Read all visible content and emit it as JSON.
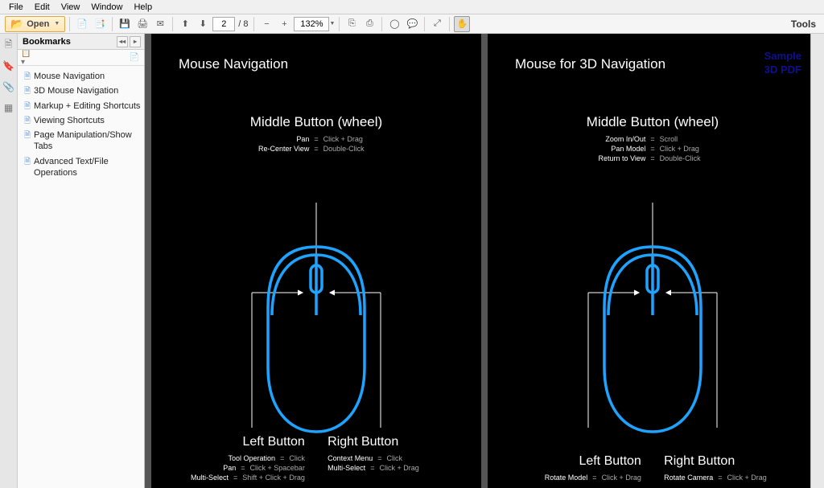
{
  "menu": [
    "File",
    "Edit",
    "View",
    "Window",
    "Help"
  ],
  "toolbar": {
    "open": "Open",
    "page_current": "2",
    "page_total": "/ 8",
    "zoom": "132%",
    "tools": "Tools"
  },
  "bookmarks": {
    "title": "Bookmarks",
    "items": [
      "Mouse Navigation",
      "3D Mouse Navigation",
      "Markup + Editing Shortcuts",
      "Viewing Shortcuts",
      "Page Manipulation/Show Tabs",
      "Advanced Text/File Operations"
    ]
  },
  "pages": [
    {
      "title": "Mouse Navigation",
      "watermark": "",
      "middle": {
        "heading": "Middle Button (wheel)",
        "rows": [
          {
            "k": "Pan",
            "v": "Click + Drag"
          },
          {
            "k": "Re-Center View",
            "v": "Double-Click"
          }
        ]
      },
      "left": {
        "heading": "Left Button",
        "rows": [
          {
            "k": "Tool Operation",
            "v": "Click"
          },
          {
            "k": "Pan",
            "v": "Click + Spacebar"
          },
          {
            "k": "Multi-Select",
            "v": "Shift + Click + Drag"
          }
        ]
      },
      "right": {
        "heading": "Right Button",
        "rows": [
          {
            "k": "Context Menu",
            "v": "Click"
          },
          {
            "k": "Multi-Select",
            "v": "Click + Drag"
          }
        ]
      }
    },
    {
      "title": "Mouse for 3D Navigation",
      "watermark": "Sample\n3D PDF",
      "middle": {
        "heading": "Middle Button (wheel)",
        "rows": [
          {
            "k": "Zoom In/Out",
            "v": "Scroll"
          },
          {
            "k": "Pan Model",
            "v": "Click + Drag"
          },
          {
            "k": "Return to View",
            "v": "Double-Click"
          }
        ]
      },
      "left": {
        "heading": "Left Button",
        "rows": [
          {
            "k": "Rotate Model",
            "v": "Click + Drag"
          }
        ]
      },
      "right": {
        "heading": "Right Button",
        "rows": [
          {
            "k": "Rotate Camera",
            "v": "Click + Drag"
          }
        ]
      }
    }
  ]
}
